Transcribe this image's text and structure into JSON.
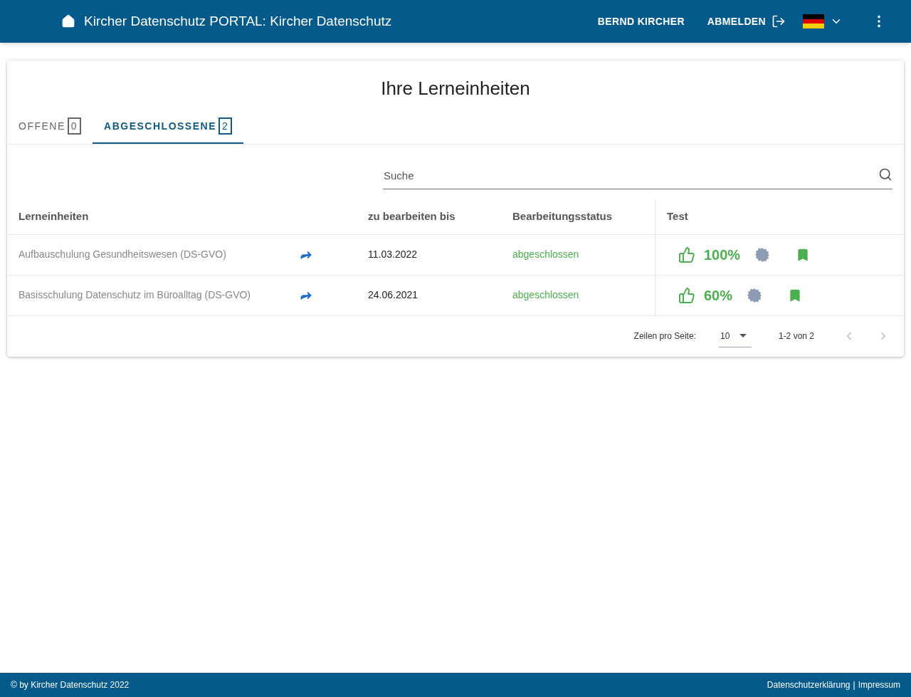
{
  "header": {
    "title": "Kircher Datenschutz PORTAL: Kircher Datenschutz",
    "user": "BERND KIRCHER",
    "logout": "ABMELDEN"
  },
  "page_title": "Ihre Lerneinheiten",
  "tabs": [
    {
      "label": "OFFENE",
      "count": "0",
      "selected": false
    },
    {
      "label": "ABGESCHLOSSENE",
      "count": "2",
      "selected": true
    }
  ],
  "search": {
    "placeholder": "Suche"
  },
  "table": {
    "columns": [
      "Lerneinheiten",
      "zu bearbeiten bis",
      "Bearbeitungsstatus",
      "Test"
    ],
    "rows": [
      {
        "name": "Aufbauschulung Gesundheitswesen (DS-GVO)",
        "due": "11.03.2022",
        "status": "abgeschlossen",
        "score": "100%"
      },
      {
        "name": "Basisschulung Datenschutz im Büroalltag (DS-GVO)",
        "due": "24.06.2021",
        "status": "abgeschlossen",
        "score": "60%"
      }
    ]
  },
  "pagination": {
    "rows_label": "Zeilen pro Seite:",
    "rows_value": "10",
    "range": "1-2 von 2"
  },
  "footer": {
    "copyright": "© by Kircher Datenschutz 2022",
    "links": [
      "Datenschutzerklärung",
      "Impressum"
    ],
    "separator": "|"
  }
}
